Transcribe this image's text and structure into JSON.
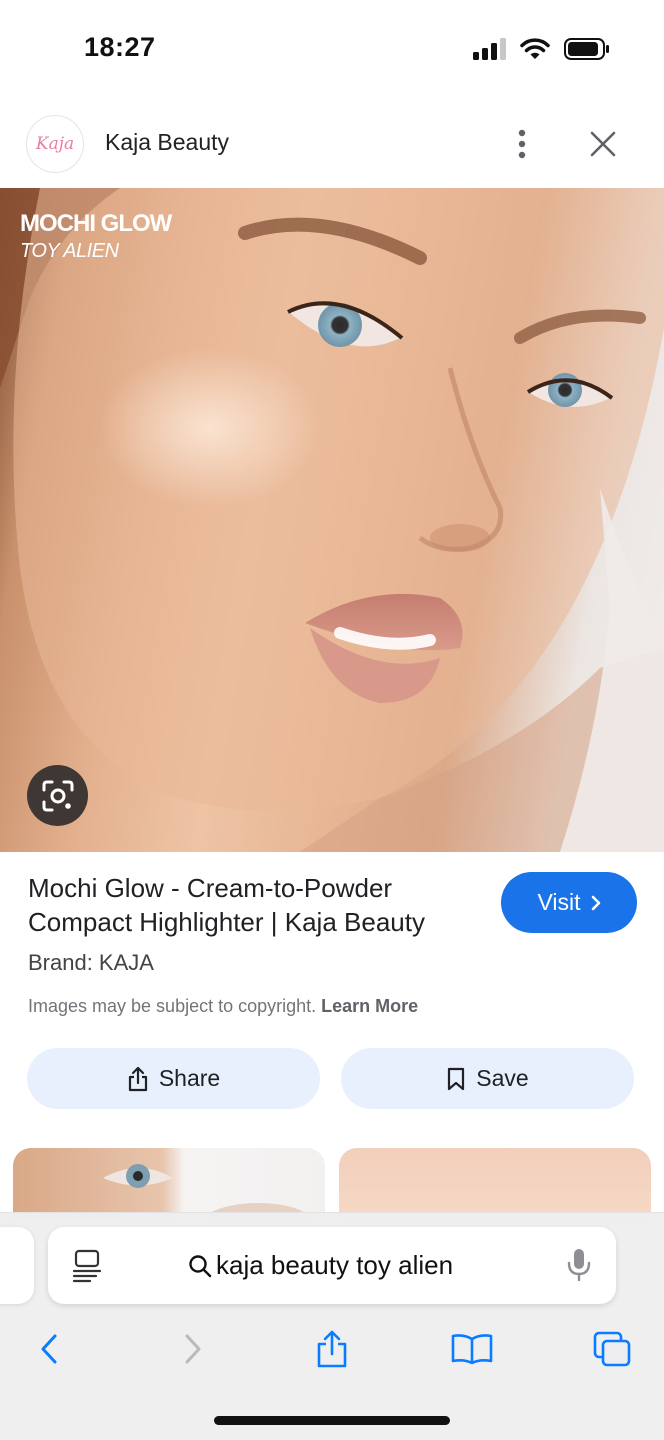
{
  "status_bar": {
    "time": "18:27"
  },
  "header": {
    "site_name": "Kaja Beauty",
    "logo_text": "Kaja"
  },
  "hero": {
    "overlay_title": "MOCHI GLOW",
    "overlay_subtitle": "TOY ALIEN",
    "lens_icon": "google-lens-icon"
  },
  "result": {
    "title": "Mochi Glow - Cream-to-Powder Compact Highlighter | Kaja Beauty",
    "brand": "Brand: KAJA",
    "copyright_text": "Images may be subject to copyright.",
    "learn_more": "Learn More",
    "visit_label": "Visit",
    "share_label": "Share",
    "save_label": "Save"
  },
  "browser": {
    "address_text": "kaja beauty toy alien"
  },
  "colors": {
    "accent": "#1a73e8",
    "button_bg": "#e8f0fe",
    "ios_blue": "#0a7cff"
  }
}
